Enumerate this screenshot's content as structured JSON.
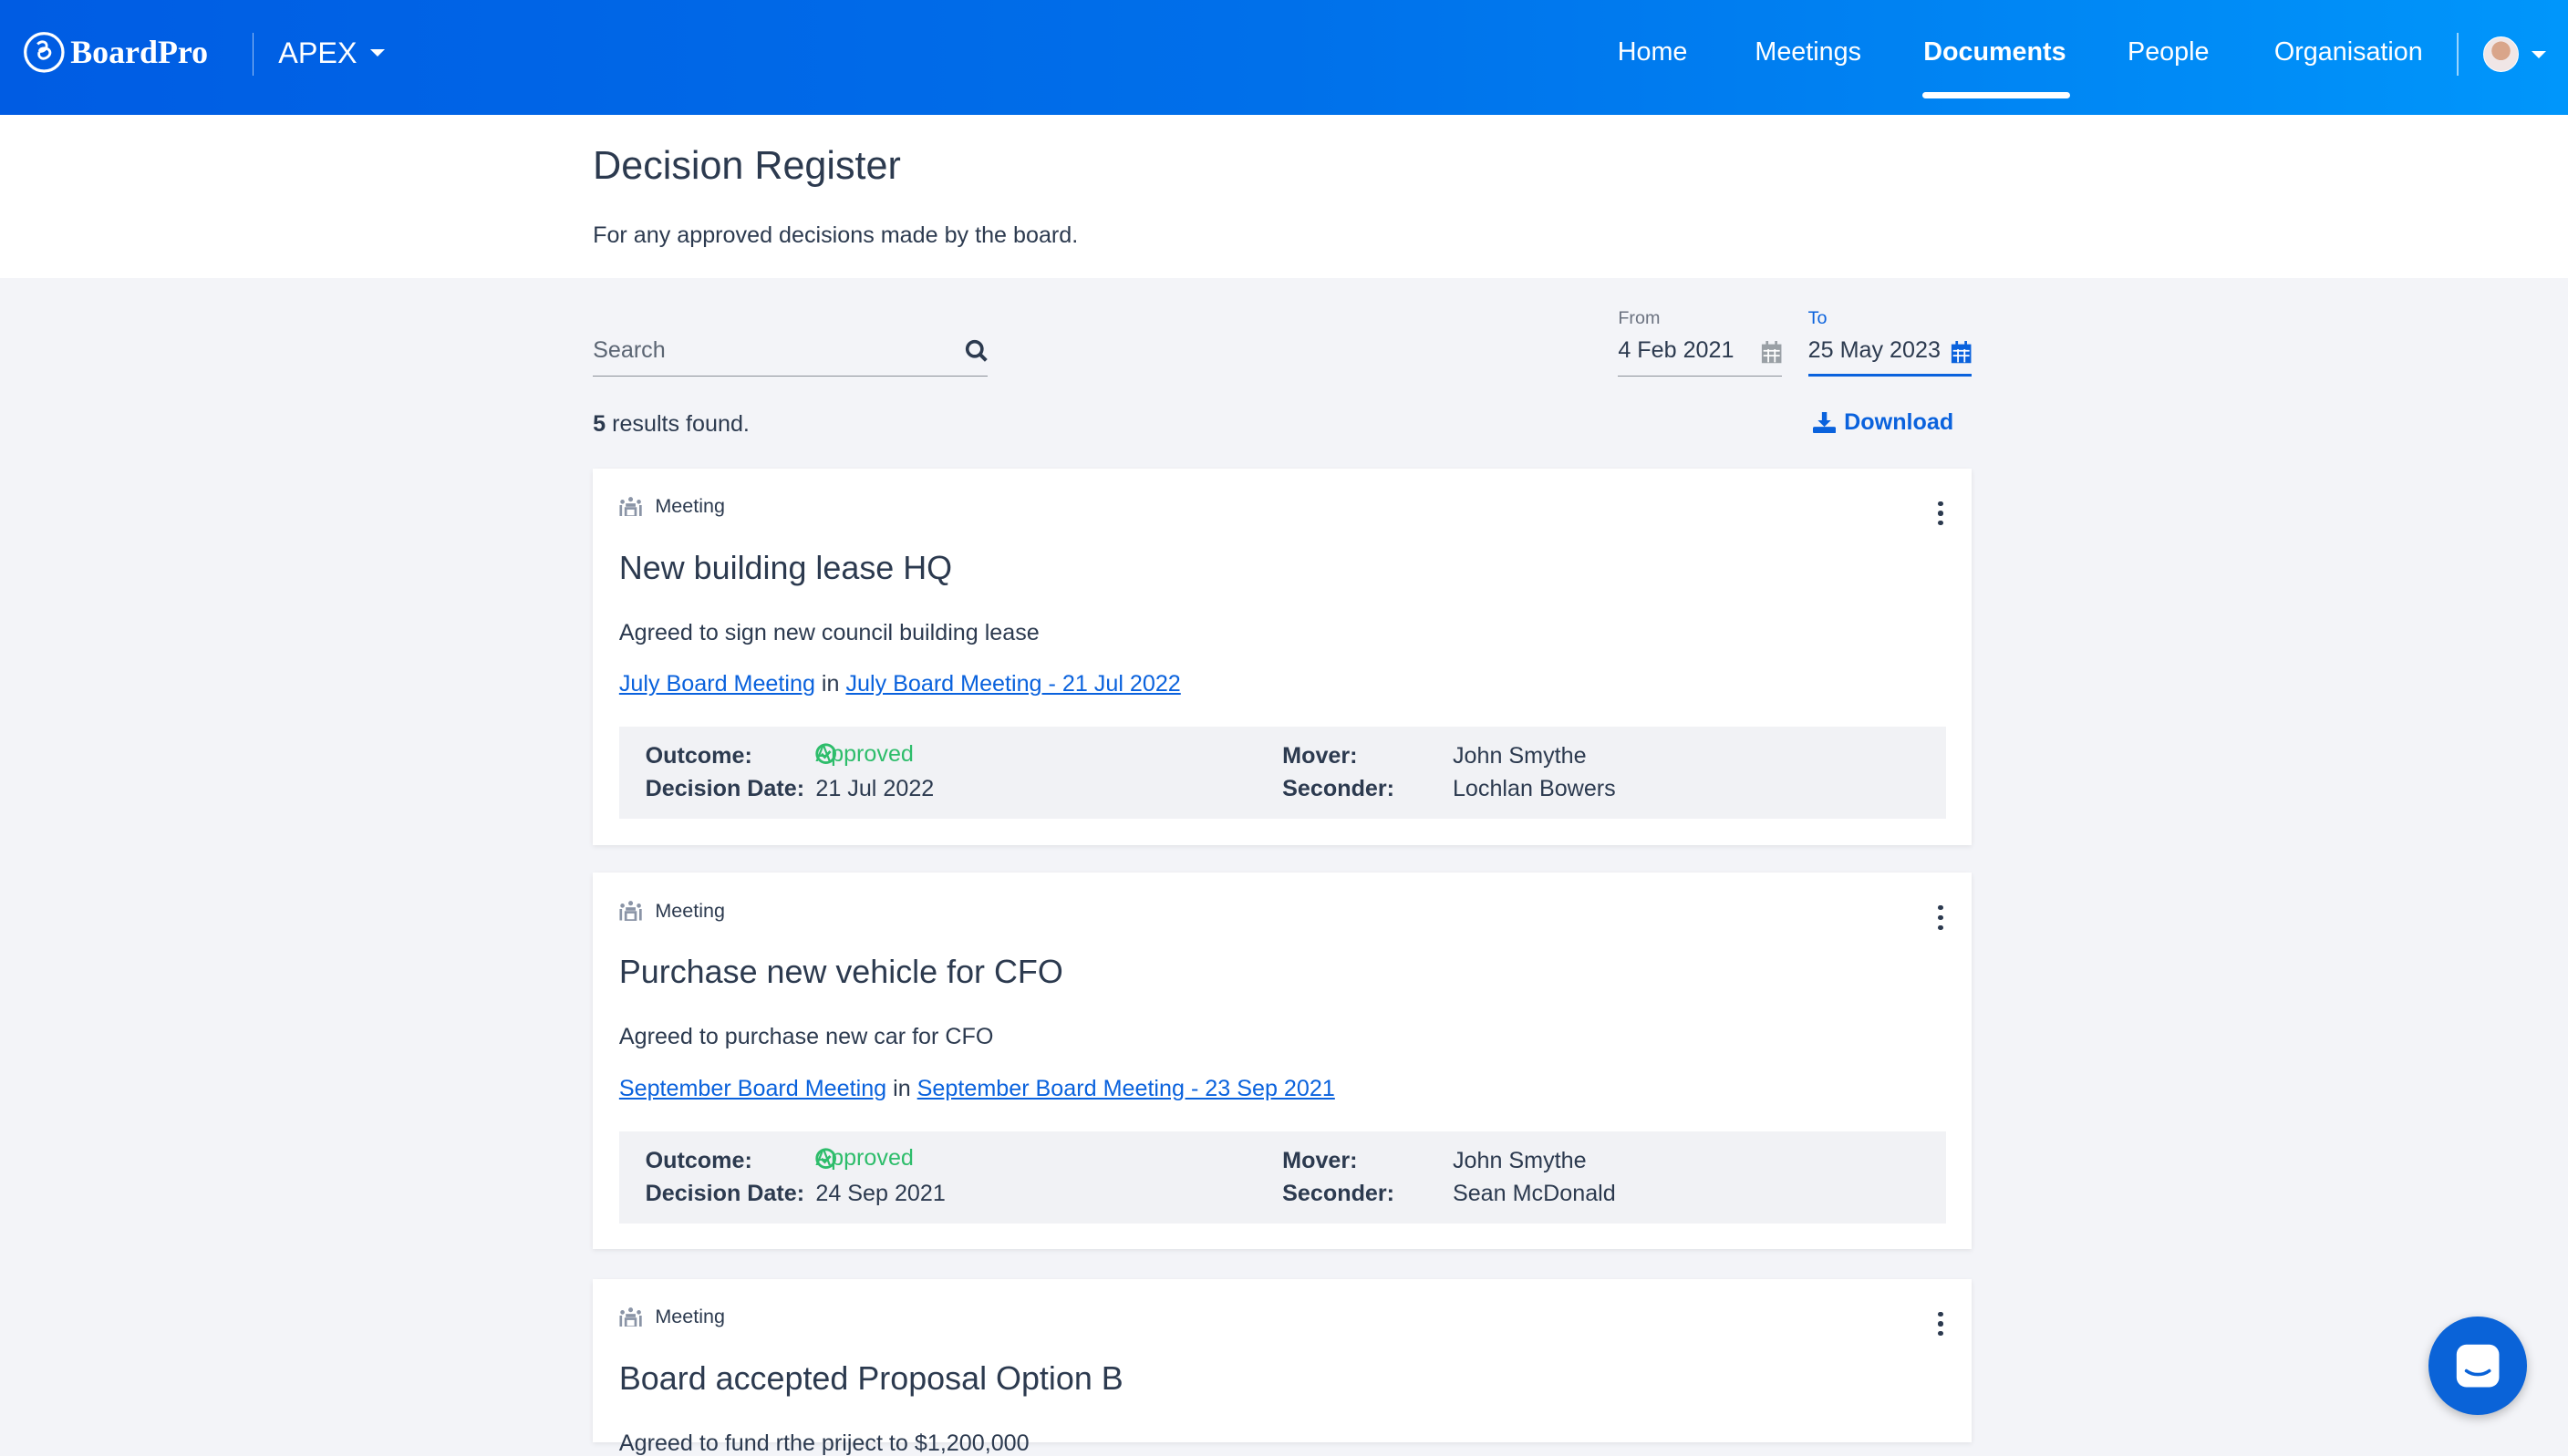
{
  "header": {
    "brand": "BoardPro",
    "org": "APEX",
    "nav": [
      {
        "label": "Home"
      },
      {
        "label": "Meetings"
      },
      {
        "label": "Documents",
        "active": true
      },
      {
        "label": "People"
      },
      {
        "label": "Organisation"
      }
    ],
    "colors": {
      "start": "#005ce3",
      "end": "#0096fb"
    }
  },
  "page": {
    "title": "Decision Register",
    "subtitle": "For any approved decisions made by the board."
  },
  "filters": {
    "search_placeholder": "Search",
    "from_label": "From",
    "from_value": "4 Feb 2021",
    "to_label": "To",
    "to_value": "25 May 2023"
  },
  "results": {
    "count": "5",
    "suffix": " results found.",
    "download": "Download"
  },
  "labels": {
    "outcome": "Outcome:",
    "decision_date": "Decision Date:",
    "mover": "Mover:",
    "seconder": "Seconder:",
    "in": "in"
  },
  "decisions": [
    {
      "type": "Meeting",
      "title": "New building lease HQ",
      "description": "Agreed to sign new council building lease",
      "meeting_link": "July Board Meeting",
      "instance_link": "July Board Meeting - 21 Jul 2022",
      "outcome": "Approved",
      "decision_date": "21 Jul 2022",
      "mover": "John Smythe",
      "seconder": "Lochlan Bowers"
    },
    {
      "type": "Meeting",
      "title": "Purchase new vehicle for CFO",
      "description": "Agreed to purchase new car for CFO",
      "meeting_link": "September Board Meeting",
      "instance_link": "September Board Meeting - 23 Sep 2021",
      "outcome": "Approved",
      "decision_date": "24 Sep 2021",
      "mover": "John Smythe",
      "seconder": "Sean McDonald"
    },
    {
      "type": "Meeting",
      "title": "Board accepted Proposal Option B",
      "description": "Agreed to fund rthe priject to $1,200,000"
    }
  ]
}
